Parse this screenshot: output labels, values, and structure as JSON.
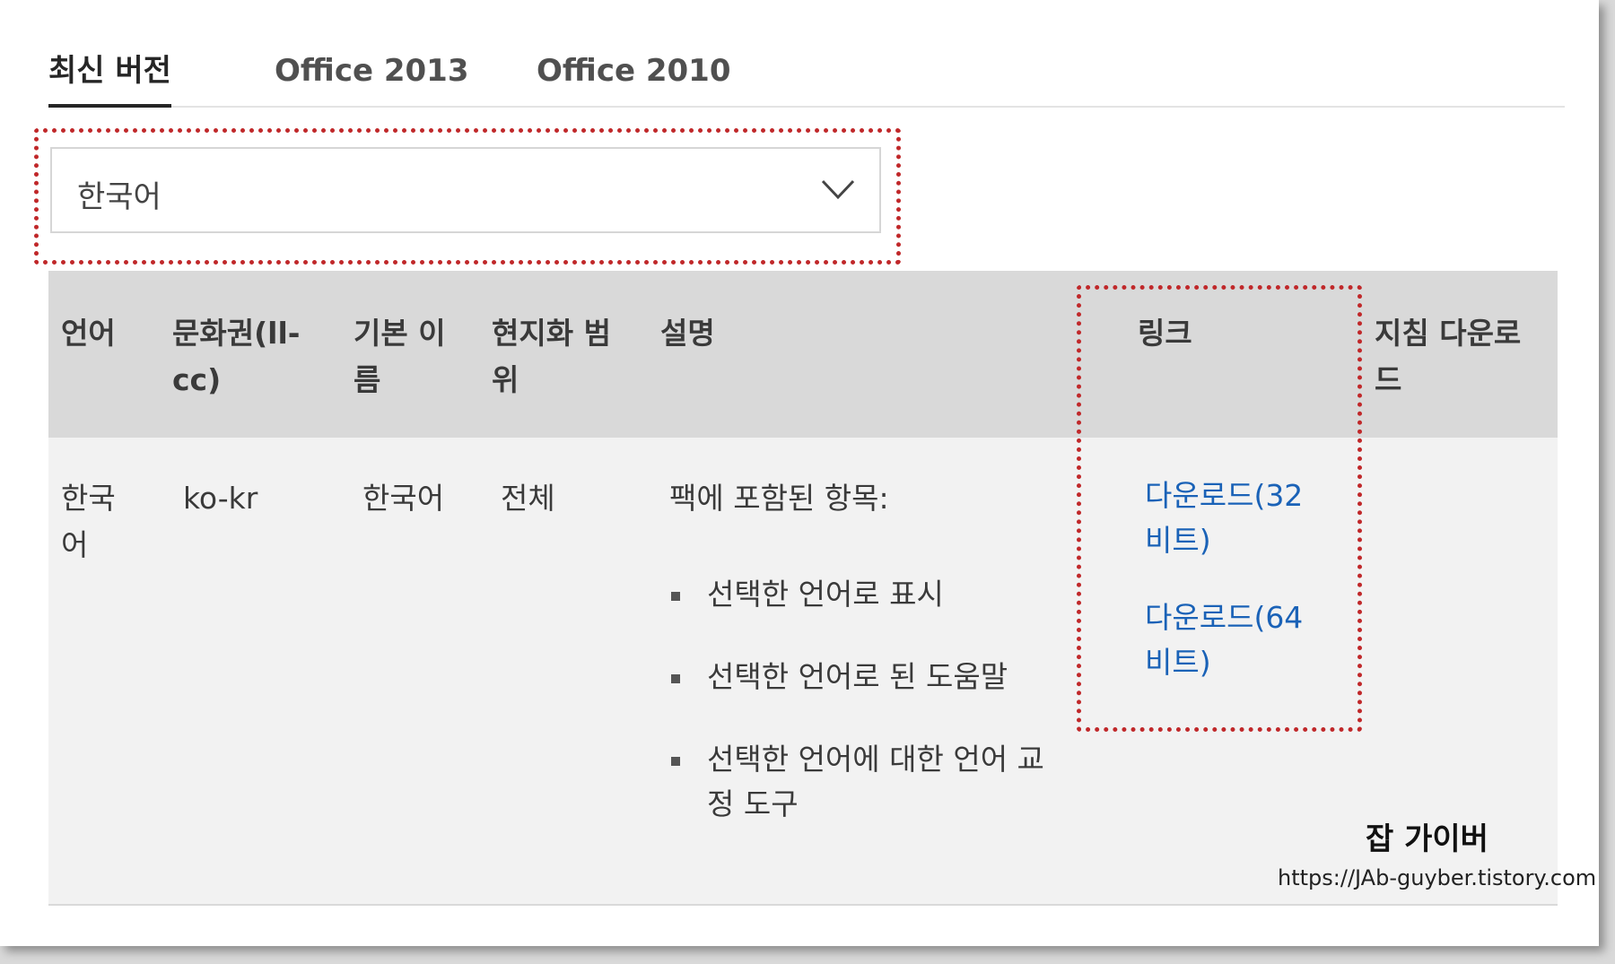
{
  "tabs": [
    {
      "label": "최신 버전",
      "active": true
    },
    {
      "label": "Office 2013",
      "active": false
    },
    {
      "label": "Office 2010",
      "active": false
    }
  ],
  "language_select": {
    "value": "한국어",
    "icon": "chevron-down-icon"
  },
  "table": {
    "headers": {
      "language": [
        "언어"
      ],
      "culture": [
        "문화권(ll-",
        "cc)"
      ],
      "base_name": [
        "기본 이",
        "름"
      ],
      "localization_scope": [
        "현지화 범",
        "위"
      ],
      "description": [
        "설명"
      ],
      "link": [
        "링크"
      ],
      "guide_download": [
        "지침 다운로",
        "드"
      ]
    },
    "row": {
      "language": [
        "한국",
        "어"
      ],
      "culture": "ko-kr",
      "base_name": "한국어",
      "localization_scope": "전체",
      "description_intro": "팩에 포함된 항목:",
      "description_items": [
        [
          "선택한 언어로 표시"
        ],
        [
          "선택한 언어로 된 도움말"
        ],
        [
          "선택한 언어에 대한 언어 교",
          "정 도구"
        ]
      ],
      "links": [
        {
          "lines": [
            "다운로드(32",
            "비트)"
          ]
        },
        {
          "lines": [
            "다운로드(64",
            "비트)"
          ]
        }
      ]
    }
  },
  "watermark": {
    "title": "잡 가이버",
    "url": "https://JAb-guyber.tistory.com"
  },
  "colors": {
    "highlight": "#c0282a",
    "link": "#1a62b7",
    "header_bg": "#d9d9d9"
  }
}
